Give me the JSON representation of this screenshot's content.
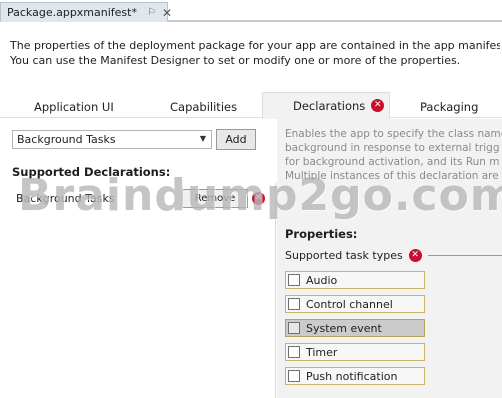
{
  "document_tab": {
    "title": "Package.appxmanifest*",
    "pin_glyph": "⚐",
    "close_glyph": "✕"
  },
  "intro": {
    "line1": "The properties of the deployment package for your app are contained in the app manifest file.",
    "line2": "You can use the Manifest Designer to set or modify one or more of the properties."
  },
  "tabs": [
    {
      "label": "Application UI",
      "has_error": false
    },
    {
      "label": "Capabilities",
      "has_error": false
    },
    {
      "label": "Declarations",
      "has_error": true,
      "selected": true
    },
    {
      "label": "Packaging",
      "has_error": false
    }
  ],
  "available_declarations": {
    "selected": "Background Tasks",
    "add_label": "Add"
  },
  "supported_declarations": {
    "title": "Supported Declarations:",
    "items": [
      {
        "label": "Background Tasks",
        "remove_label": "Remove",
        "has_error": true
      }
    ]
  },
  "description": {
    "lines": [
      "Enables the app to specify the class name",
      "background in response to external trigg",
      "for background activation, and its Run m",
      "Multiple instances of this declaration are"
    ]
  },
  "properties": {
    "title": "Properties:",
    "supported_task_types_label": "Supported task types",
    "task_types": [
      {
        "label": "Audio",
        "checked": false,
        "selected": false
      },
      {
        "label": "Control channel",
        "checked": false,
        "selected": false
      },
      {
        "label": "System event",
        "checked": false,
        "selected": true
      },
      {
        "label": "Timer",
        "checked": false,
        "selected": false
      },
      {
        "label": "Push notification",
        "checked": false,
        "selected": false
      }
    ]
  },
  "watermark": {
    "text": "Braindump2go.com"
  },
  "colors": {
    "error_red": "#c8102e",
    "selected_tab_bg": "#f2f2f2",
    "selected_row_bg": "#cbcbcb",
    "checkbox_border": "#c9b26a"
  }
}
